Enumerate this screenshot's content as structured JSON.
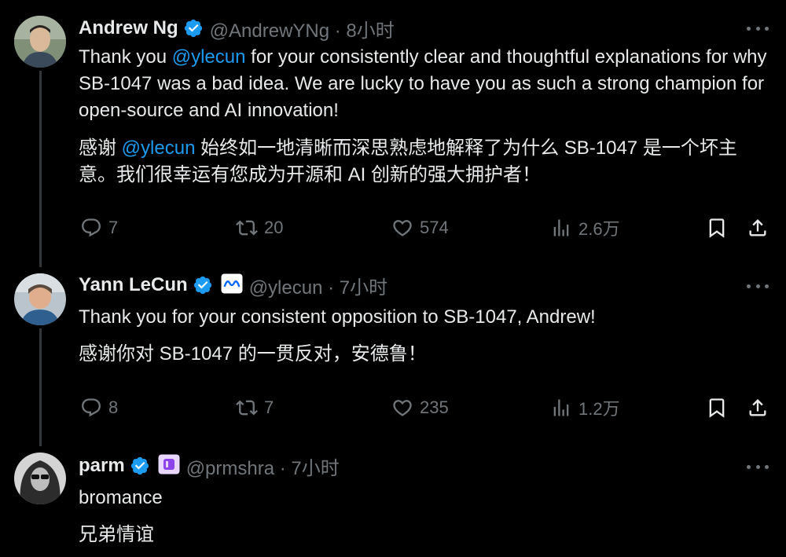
{
  "colors": {
    "background": "#000000",
    "text": "#e7e9ea",
    "muted": "#71767b",
    "accent": "#1d9bf0"
  },
  "tweets": [
    {
      "name": "Andrew Ng",
      "handle": "@AndrewYNg · 8小时",
      "verified_icon": "verified-badge-icon",
      "text_en": {
        "pre": "Thank you ",
        "mention": "@ylecun",
        "post": " for your consistently clear and thoughtful explanations for why SB-1047 was a bad idea. We are lucky to have you as such a strong champion for open-source and AI innovation!"
      },
      "text_zh": {
        "pre": "感谢 ",
        "mention": "@ylecun",
        "post": " 始终如一地清晰而深思熟虑地解释了为什么 SB-1047 是一个坏主意。我们很幸运有您成为开源和 AI 创新的强大拥护者！"
      },
      "replies": "7",
      "reposts": "20",
      "likes": "574",
      "views": "2.6万"
    },
    {
      "name": "Yann LeCun",
      "handle": "@ylecun · 7小时",
      "verified_icon": "verified-badge-icon",
      "affiliation_icon": "meta-logo-icon",
      "text_en": "Thank you for your consistent opposition to SB-1047, Andrew!",
      "text_zh": "感谢你对 SB-1047 的一贯反对，安德鲁！",
      "replies": "8",
      "reposts": "7",
      "likes": "235",
      "views": "1.2万"
    },
    {
      "name": "parm",
      "handle": "@prmshra · 7小时",
      "verified_icon": "verified-badge-icon",
      "affiliation_icon": "purple-affiliate-icon",
      "text_en": "bromance",
      "text_zh": "兄弟情谊"
    }
  ]
}
